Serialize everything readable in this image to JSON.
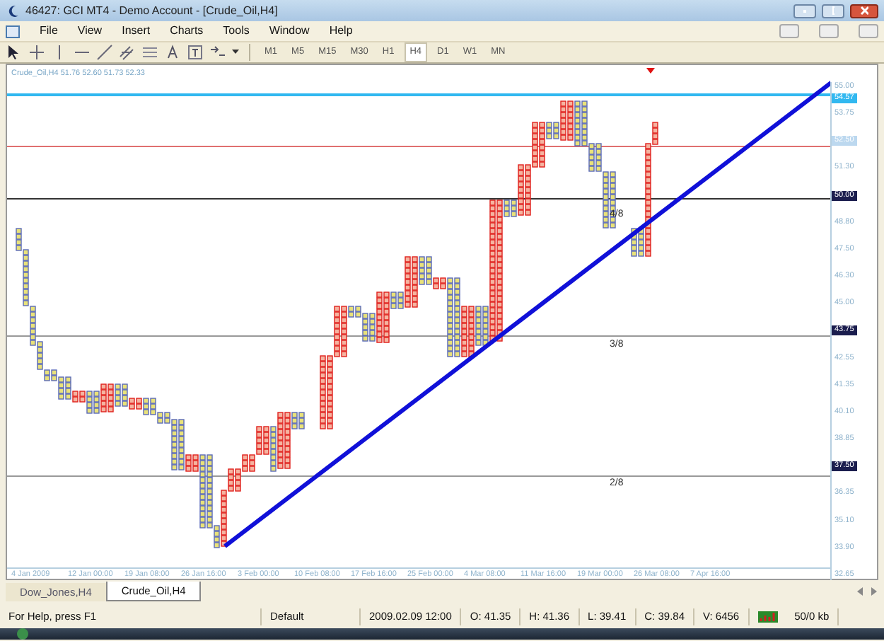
{
  "window": {
    "title": "46427: GCI MT4 - Demo Account - [Crude_Oil,H4]"
  },
  "menu": [
    "File",
    "View",
    "Insert",
    "Charts",
    "Tools",
    "Window",
    "Help"
  ],
  "timeframes": [
    {
      "label": "M1",
      "selected": false
    },
    {
      "label": "M5",
      "selected": false
    },
    {
      "label": "M15",
      "selected": false
    },
    {
      "label": "M30",
      "selected": false
    },
    {
      "label": "H1",
      "selected": false
    },
    {
      "label": "H4",
      "selected": true
    },
    {
      "label": "D1",
      "selected": false
    },
    {
      "label": "W1",
      "selected": false
    },
    {
      "label": "MN",
      "selected": false
    }
  ],
  "chart": {
    "header": "Crude_Oil,H4  51.76 52.60 51.73 52.33",
    "line_label": "54.57",
    "price_ticks": [
      {
        "text": "55.00",
        "kind": "tick"
      },
      {
        "text": "53.75",
        "kind": "tick"
      },
      {
        "text": "52.50",
        "kind": "bid"
      },
      {
        "text": "51.30",
        "kind": "tick"
      },
      {
        "text": "50.00",
        "kind": "level"
      },
      {
        "text": "48.80",
        "kind": "tick"
      },
      {
        "text": "47.50",
        "kind": "tick"
      },
      {
        "text": "46.30",
        "kind": "tick"
      },
      {
        "text": "45.00",
        "kind": "tick"
      },
      {
        "text": "43.75",
        "kind": "level"
      },
      {
        "text": "42.55",
        "kind": "tick"
      },
      {
        "text": "41.35",
        "kind": "tick"
      },
      {
        "text": "40.10",
        "kind": "tick"
      },
      {
        "text": "38.85",
        "kind": "tick"
      },
      {
        "text": "37.50",
        "kind": "level"
      },
      {
        "text": "36.35",
        "kind": "tick"
      },
      {
        "text": "35.10",
        "kind": "tick"
      },
      {
        "text": "33.90",
        "kind": "tick"
      },
      {
        "text": "32.65",
        "kind": "tick"
      }
    ],
    "time_ticks": [
      "4 Jan 2009",
      "12 Jan 00:00",
      "19 Jan 08:00",
      "26 Jan 16:00",
      "3 Feb 00:00",
      "10 Feb 08:00",
      "17 Feb 16:00",
      "25 Feb 00:00",
      "4 Mar 08:00",
      "11 Mar 16:00",
      "19 Mar 00:00",
      "26 Mar 08:00",
      "7 Apr 16:00"
    ],
    "level_labels": [
      "4/8",
      "3/8",
      "2/8"
    ]
  },
  "tabs": [
    {
      "label": "Dow_Jones,H4",
      "selected": false
    },
    {
      "label": "Crude_Oil,H4",
      "selected": true
    }
  ],
  "status_bar": {
    "help": "For Help, press F1",
    "profile": "Default",
    "time": "2009.02.09 12:00",
    "open": "O: 41.35",
    "high": "H: 41.36",
    "low": "L: 39.41",
    "close": "C: 39.84",
    "volume": "V: 6456",
    "traffic": "50/0 kb"
  }
}
